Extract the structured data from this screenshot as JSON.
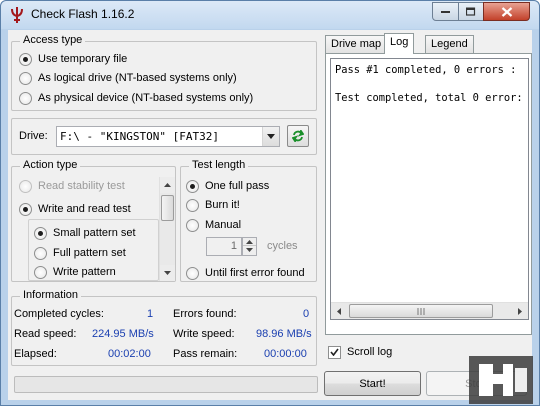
{
  "window": {
    "title": "Check Flash 1.16.2",
    "controls": [
      "minimize-icon",
      "maximize-icon",
      "close-icon"
    ]
  },
  "access_type": {
    "title": "Access type",
    "options": [
      {
        "label": "Use temporary file",
        "checked": true
      },
      {
        "label": "As logical drive (NT-based systems only)",
        "checked": false
      },
      {
        "label": "As physical device (NT-based systems only)",
        "checked": false
      }
    ]
  },
  "drive": {
    "label": "Drive:",
    "selected": "F:\\ - \"KINGSTON\" [FAT32]",
    "refresh_icon": "refresh-icon"
  },
  "action_type": {
    "title": "Action type",
    "options": [
      {
        "label": "Read stability test",
        "checked": false,
        "disabled": true
      },
      {
        "label": "Write and read test",
        "checked": true,
        "disabled": false
      }
    ],
    "sub_options": [
      {
        "label": "Small pattern set",
        "checked": true
      },
      {
        "label": "Full pattern set",
        "checked": false
      },
      {
        "label": "Write pattern",
        "checked": false
      }
    ]
  },
  "test_length": {
    "title": "Test length",
    "options": [
      {
        "label": "One full pass",
        "checked": true
      },
      {
        "label": "Burn it!",
        "checked": false
      },
      {
        "label": "Manual",
        "checked": false
      },
      {
        "label": "Until first error found",
        "checked": false
      }
    ],
    "cycles_value": "1",
    "cycles_label": "cycles"
  },
  "information": {
    "title": "Information",
    "completed_cycles_label": "Completed cycles:",
    "completed_cycles_value": "1",
    "errors_found_label": "Errors found:",
    "errors_found_value": "0",
    "read_speed_label": "Read speed:",
    "read_speed_value": "224.95 MB/s",
    "write_speed_label": "Write speed:",
    "write_speed_value": "98.96 MB/s",
    "elapsed_label": "Elapsed:",
    "elapsed_value": "00:02:00",
    "pass_remain_label": "Pass remain:",
    "pass_remain_value": "00:00:00"
  },
  "tabs": [
    {
      "label": "Drive map",
      "active": false
    },
    {
      "label": "Log",
      "active": true
    },
    {
      "label": "Legend",
      "active": false
    }
  ],
  "log": {
    "lines": [
      "Pass #1 completed, 0 errors :",
      "",
      "Test completed, total 0 error:"
    ]
  },
  "scroll_log": {
    "label": "Scroll log",
    "checked": true
  },
  "buttons": {
    "start": "Start!",
    "stop": "Stop"
  },
  "progress": {
    "fraction": 0
  },
  "colors": {
    "value_blue": "#1a3fb0",
    "window_frame": "#b9d1ea",
    "close_red": "#c3412a"
  }
}
